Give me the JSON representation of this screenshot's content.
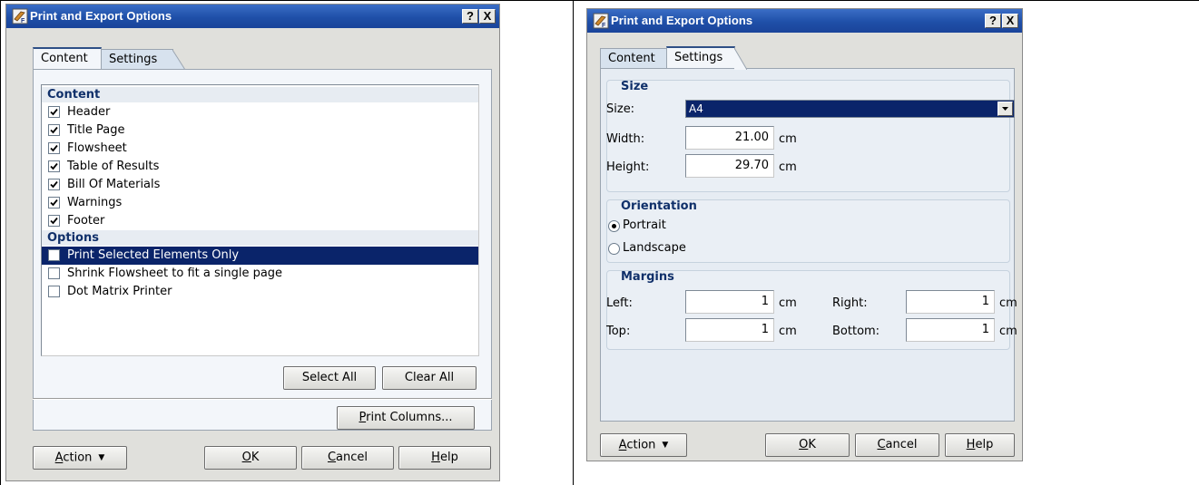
{
  "left_dialog": {
    "title": "Print and Export Options",
    "help_glyph": "?",
    "close_glyph": "X",
    "tabs": [
      "Content",
      "Settings"
    ],
    "content_group": {
      "heading": "Content",
      "items": [
        {
          "label": "Header",
          "checked": true
        },
        {
          "label": "Title Page",
          "checked": true
        },
        {
          "label": "Flowsheet",
          "checked": true
        },
        {
          "label": "Table of Results",
          "checked": true
        },
        {
          "label": "Bill Of Materials",
          "checked": true
        },
        {
          "label": "Warnings",
          "checked": true
        },
        {
          "label": "Footer",
          "checked": true
        }
      ]
    },
    "options_group": {
      "heading": "Options",
      "items": [
        {
          "label": "Print Selected Elements Only",
          "checked": false,
          "selected": true
        },
        {
          "label": "Shrink Flowsheet to fit a single page",
          "checked": false
        },
        {
          "label": "Dot Matrix Printer",
          "checked": false
        }
      ]
    },
    "buttons": {
      "select_all": "Select All",
      "clear_all": "Clear All",
      "print_columns_u": "P",
      "print_columns_rest": "rint Columns...",
      "action_u": "A",
      "action_rest": "ction",
      "ok_u": "O",
      "ok_rest": "K",
      "cancel_u": "C",
      "cancel_rest": "ancel",
      "help_u": "H",
      "help_rest": "elp"
    }
  },
  "right_dialog": {
    "title": "Print and Export Options",
    "help_glyph": "?",
    "close_glyph": "X",
    "tabs": [
      "Content",
      "Settings"
    ],
    "size_section": {
      "heading": "Size",
      "size_label": "Size:",
      "size_value": "A4",
      "width_label": "Width:",
      "width_value": "21.00",
      "height_label": "Height:",
      "height_value": "29.70",
      "unit": "cm"
    },
    "orientation_section": {
      "heading": "Orientation",
      "portrait": "Portrait",
      "landscape": "Landscape",
      "selected": "Portrait"
    },
    "margins_section": {
      "heading": "Margins",
      "left_label": "Left:",
      "left_value": "1",
      "right_label": "Right:",
      "right_value": "1",
      "top_label": "Top:",
      "top_value": "1",
      "bottom_label": "Bottom:",
      "bottom_value": "1",
      "unit": "cm"
    },
    "buttons": {
      "action_u": "A",
      "action_rest": "ction",
      "ok_u": "O",
      "ok_rest": "K",
      "cancel_u": "C",
      "cancel_rest": "ancel",
      "help_u": "H",
      "help_rest": "elp"
    }
  },
  "icons": {
    "app_icon": "print-export-app-icon",
    "dropdown_caret": "▼",
    "check": "check-icon"
  },
  "colors": {
    "title_bar": "#1f4fa8",
    "selection": "#0a246a",
    "section_heading": "#10306a",
    "dialog_face": "#e0e0dc",
    "panel": "#f3f6fa"
  }
}
